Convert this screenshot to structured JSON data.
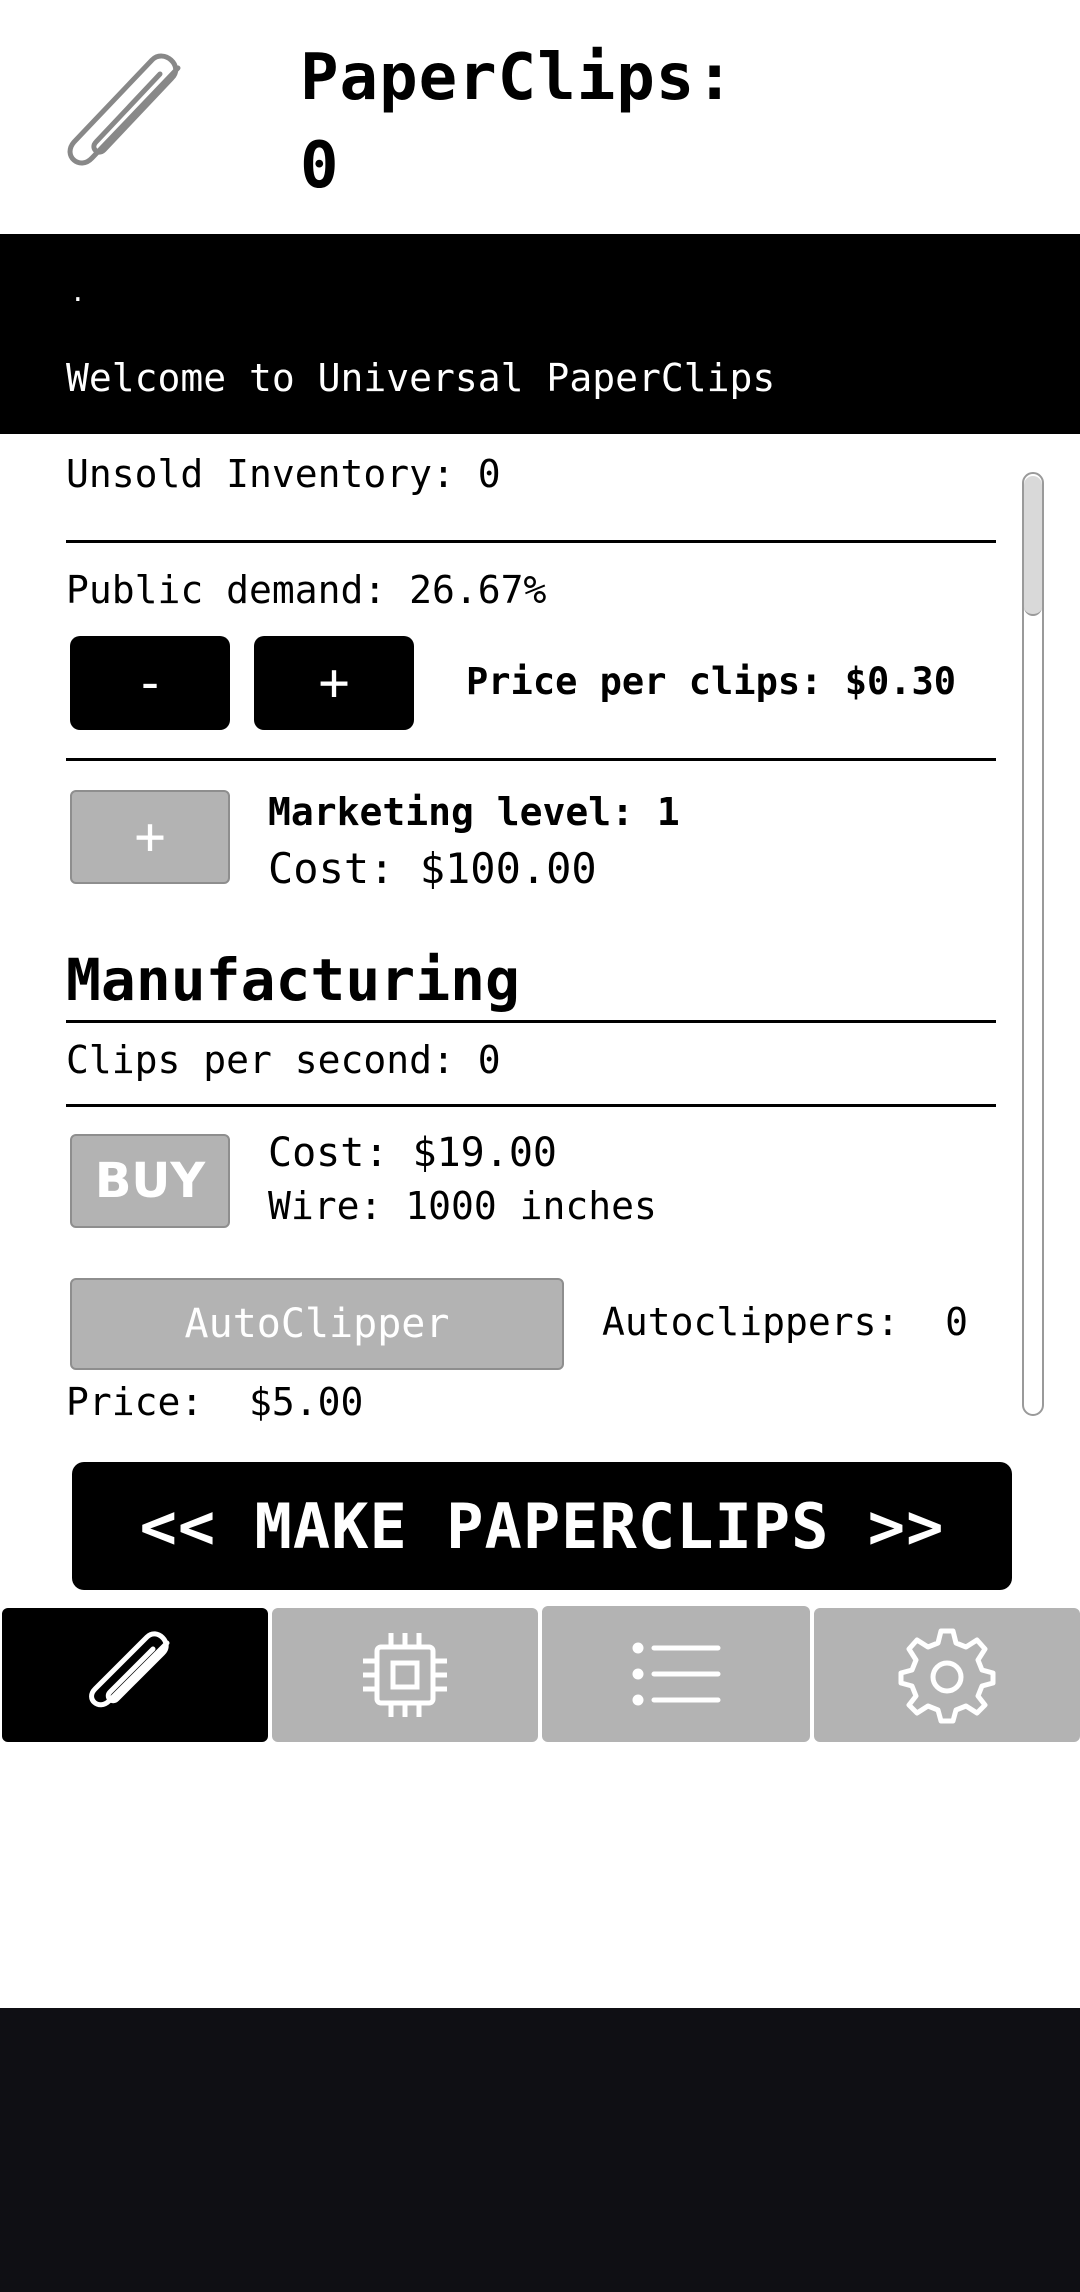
{
  "header": {
    "title_line1": "PaperClips:",
    "clip_count": "0"
  },
  "console": {
    "dot": ".",
    "message": "Welcome to Universal PaperClips"
  },
  "business": {
    "unsold_inventory": "Unsold Inventory: 0",
    "public_demand": "Public demand: 26.67%",
    "minus_label": "-",
    "plus_label": "+",
    "price_per_clip": "Price per clips: $0.30",
    "marketing_plus": "+",
    "marketing_level": "Marketing level: 1",
    "marketing_cost": "Cost: $100.00"
  },
  "manufacturing": {
    "title": "Manufacturing",
    "clips_per_second": "Clips per second: 0",
    "buy_label": "BUY",
    "wire_cost": "Cost: $19.00",
    "wire_amount": "Wire: 1000 inches",
    "autoclipper_label": "AutoClipper",
    "autoclippers_count": "Autoclippers:  0",
    "autoclipper_price": "Price:  $5.00"
  },
  "make_button": "<< MAKE PAPERCLIPS >>",
  "tabs": [
    {
      "icon": "paperclip-icon",
      "active": true
    },
    {
      "icon": "chip-icon",
      "active": false
    },
    {
      "icon": "list-icon",
      "active": false
    },
    {
      "icon": "gear-icon",
      "active": false
    }
  ],
  "colors": {
    "black": "#000000",
    "gray_button": "#b3b3b3",
    "bottom_band": "#0f0f14"
  }
}
